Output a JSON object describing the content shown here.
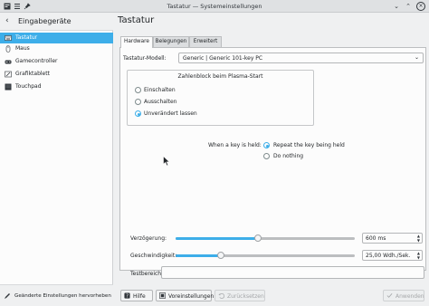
{
  "window": {
    "title": "Tastatur — Systemeinstellungen"
  },
  "sidebar": {
    "header": "Eingabegeräte",
    "items": [
      {
        "label": "Tastatur",
        "icon": "keyboard-icon"
      },
      {
        "label": "Maus",
        "icon": "mouse-icon"
      },
      {
        "label": "Gamecontroller",
        "icon": "gamecontroller-icon"
      },
      {
        "label": "Grafiktablett",
        "icon": "tablet-icon"
      },
      {
        "label": "Touchpad",
        "icon": "touchpad-icon"
      }
    ],
    "footer": "Geänderte Einstellungen hervorheben"
  },
  "main": {
    "title": "Tastatur",
    "tabs": [
      {
        "label": "Hardware"
      },
      {
        "label": "Belegungen"
      },
      {
        "label": "Erweitert"
      }
    ],
    "model_label": "Tastatur-Modell:",
    "model_value": "Generic | Generic 101-key PC",
    "numlock": {
      "title": "Zahlenblock beim Plasma-Start",
      "options": [
        {
          "label": "Einschalten"
        },
        {
          "label": "Ausschalten"
        },
        {
          "label": "Unverändert lassen"
        }
      ],
      "selected": "Unverändert lassen"
    },
    "held": {
      "label": "When a key is held:",
      "options": [
        {
          "label": "Repeat the key being held"
        },
        {
          "label": "Do nothing"
        }
      ],
      "selected": "Repeat the key being held"
    },
    "delay": {
      "label": "Verzögerung:",
      "value": "600 ms",
      "level": 0.46
    },
    "rate": {
      "label": "Geschwindigkeit:",
      "value": "25,00 Wdh./Sek.",
      "level": 0.25
    },
    "test_label": "Testbereich:"
  },
  "footer": {
    "help": "Hilfe",
    "defaults": "Voreinstellungen",
    "reset": "Zurücksetzen",
    "apply": "Anwenden"
  },
  "colors": {
    "accent": "#3daee9",
    "window_bg": "#eff0f1",
    "text": "#232629"
  }
}
